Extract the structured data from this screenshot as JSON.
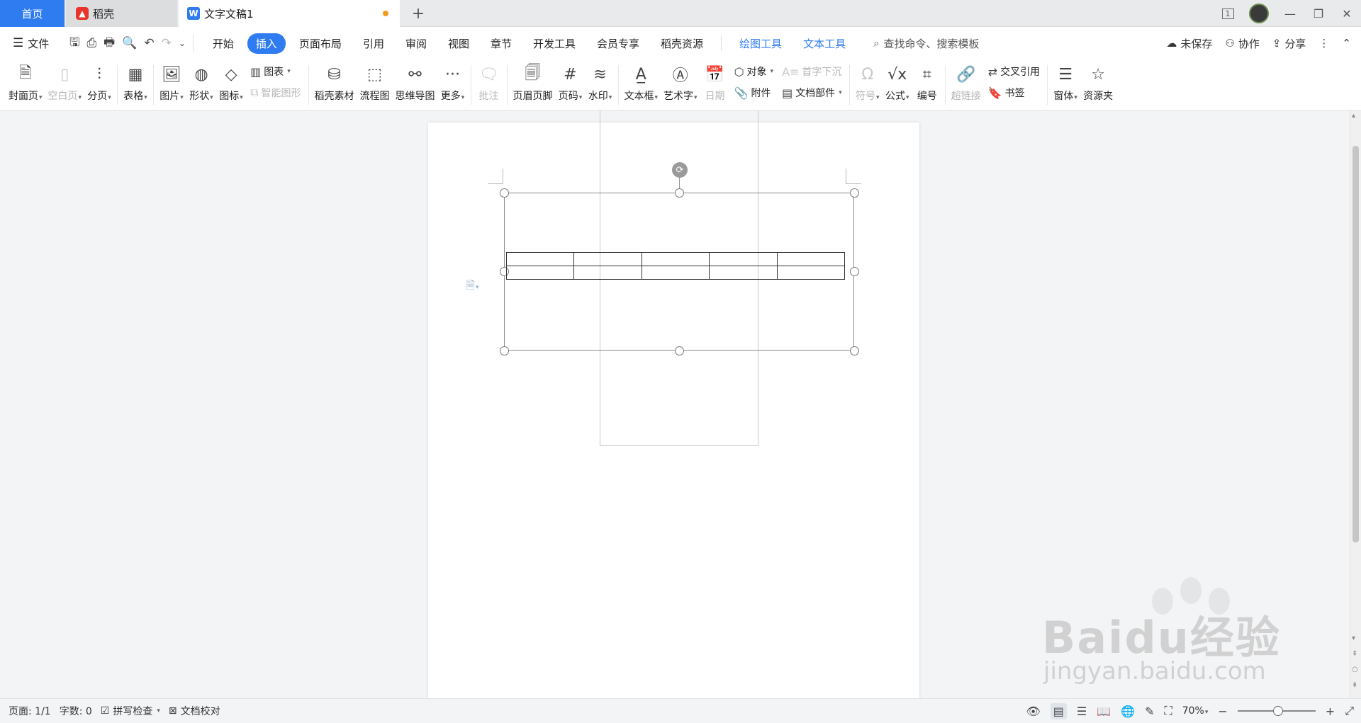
{
  "tabs": {
    "home": "首页",
    "daoke": "稻壳",
    "doc": "文字文稿1",
    "add": "+"
  },
  "window": {
    "page_badge": "1",
    "minimize": "—",
    "restore": "❐",
    "close": "✕"
  },
  "menubar": {
    "file": "文件",
    "menus": [
      "开始",
      "插入",
      "页面布局",
      "引用",
      "审阅",
      "视图",
      "章节",
      "开发工具",
      "会员专享",
      "稻壳资源"
    ],
    "active_menu": "插入",
    "context_tabs": [
      "绘图工具",
      "文本工具"
    ],
    "search": "查找命令、搜索模板",
    "unsaved": "未保存",
    "collab": "协作",
    "share": "分享"
  },
  "ribbon": {
    "cover": "封面页",
    "blank": "空白页",
    "pagebreak": "分页",
    "table": "表格",
    "picture": "图片",
    "shape": "形状",
    "icon": "图标",
    "chart": "图表",
    "smartart": "智能图形",
    "daoke_material": "稻壳素材",
    "flowchart": "流程图",
    "mindmap": "思维导图",
    "more": "更多",
    "comment": "批注",
    "header_footer": "页眉页脚",
    "page_number": "页码",
    "watermark": "水印",
    "textbox": "文本框",
    "wordart": "艺术字",
    "date": "日期",
    "object": "对象",
    "attachment": "附件",
    "dropcap": "首字下沉",
    "doc_parts": "文档部件",
    "symbol": "符号",
    "formula": "公式",
    "numbering": "编号",
    "hyperlink": "超链接",
    "crossref": "交叉引用",
    "bookmark": "书签",
    "form": "窗体",
    "resource": "资源夹"
  },
  "status": {
    "page": "页面: 1/1",
    "words": "字数: 0",
    "spell": "拼写检查",
    "proof": "文档校对",
    "zoom": "70%"
  },
  "watermark": {
    "brand": "Bai",
    "brand2": "du",
    "cn": "经验",
    "url": "jingyan.baidu.com"
  },
  "table": {
    "rows": 2,
    "cols": 5
  },
  "colors": {
    "accent": "#2f7bf0",
    "unsaved_dot": "#f29c1f"
  }
}
